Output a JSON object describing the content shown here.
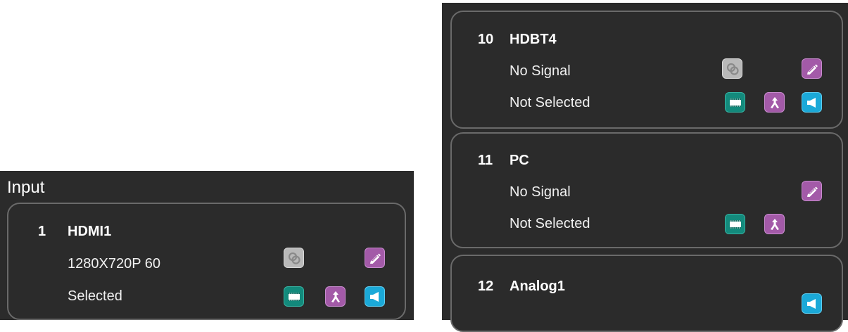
{
  "input_panel": {
    "title": "Input",
    "cards": [
      {
        "number": "1",
        "name": "HDMI1",
        "signal": "1280X720P 60",
        "status": "Selected"
      }
    ]
  },
  "right_panel": {
    "cards": [
      {
        "number": "10",
        "name": "HDBT4",
        "signal": "No Signal",
        "status": "Not Selected"
      },
      {
        "number": "11",
        "name": "PC",
        "signal": "No Signal",
        "status": "Not Selected"
      },
      {
        "number": "12",
        "name": "Analog1"
      }
    ]
  },
  "icons": {
    "link": {
      "name": "link-icon",
      "color": "#b9b9b9"
    },
    "edit": {
      "name": "pencil-edit-icon",
      "color": "#a35aa8"
    },
    "video": {
      "name": "video-icon",
      "color": "#138a7c"
    },
    "route": {
      "name": "route-merge-icon",
      "color": "#a35aa8"
    },
    "audio": {
      "name": "speaker-icon",
      "color": "#1ba9d8"
    }
  }
}
